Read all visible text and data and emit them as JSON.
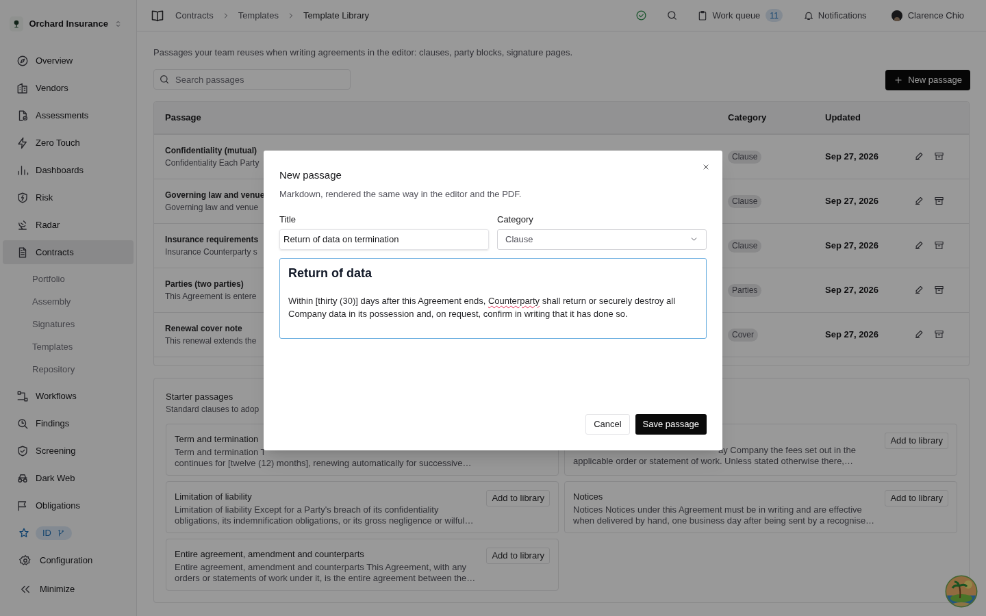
{
  "sidebar": {
    "org": "Orchard Insurance",
    "items": [
      {
        "label": "Overview",
        "selected": false
      },
      {
        "label": "Vendors",
        "selected": false
      },
      {
        "label": "Assessments",
        "selected": false
      },
      {
        "label": "Zero Touch",
        "selected": false
      },
      {
        "label": "Dashboards",
        "selected": false
      },
      {
        "label": "Risk",
        "selected": false
      },
      {
        "label": "Radar",
        "selected": false
      },
      {
        "label": "Contracts",
        "selected": true,
        "children": [
          {
            "label": "Portfolio"
          },
          {
            "label": "Assembly"
          },
          {
            "label": "Signatures"
          },
          {
            "label": "Templates"
          },
          {
            "label": "Repository"
          }
        ]
      },
      {
        "label": "Workflows",
        "selected": false
      },
      {
        "label": "Findings",
        "selected": false
      },
      {
        "label": "Screening",
        "selected": false
      },
      {
        "label": "Dark Web",
        "selected": false
      },
      {
        "label": "Obligations",
        "selected": false
      }
    ],
    "id_badge": "ID",
    "footer": [
      {
        "label": "Configuration"
      },
      {
        "label": "Minimize"
      }
    ]
  },
  "breadcrumbs": [
    "Contracts",
    "Templates",
    "Template Library"
  ],
  "header": {
    "work_queue": "Work queue",
    "work_queue_count": "11",
    "notifications": "Notifications",
    "user": "Clarence Chio"
  },
  "intro": "Passages your team reuses when writing agreements in the editor: clauses, party blocks, signature pages.",
  "search": {
    "placeholder": "Search passages"
  },
  "new_button": "New passage",
  "table": {
    "columns": [
      "Passage",
      "Category",
      "Updated"
    ],
    "rows": [
      {
        "title": "Confidentiality (mutual)",
        "excerpt": "Confidentiality Each Party",
        "category": "Clause",
        "updated": "Sep 27, 2026"
      },
      {
        "title": "Governing law and venue",
        "excerpt": "Governing law and venue",
        "category": "Clause",
        "updated": "Sep 27, 2026"
      },
      {
        "title": "Insurance requirements",
        "excerpt": "Insurance Counterparty s",
        "category": "Clause",
        "updated": "Sep 27, 2026"
      },
      {
        "title": "Parties (two parties)",
        "excerpt": "This Agreement is entere",
        "category": "Parties",
        "updated": "Sep 27, 2026"
      },
      {
        "title": "Renewal cover note",
        "excerpt": "This renewal extends the",
        "category": "Cover",
        "updated": "Sep 27, 2026"
      }
    ]
  },
  "starter": {
    "title": "Starter passages",
    "subtitle": "Standard clauses to adop",
    "cards": [
      {
        "title": "Term and termination",
        "lines": [
          {
            "text": "Term and termination T",
            "kind": "head"
          },
          {
            "text": "continues for [twelve (12) months], renewing automatically for successive…",
            "kind": "full"
          }
        ]
      },
      {
        "lines": [
          {
            "text": "ay Company the fees set out in the",
            "kind": "tail"
          },
          {
            "text": "applicable order or statement of work. Unless stated otherwise there,…",
            "kind": "full"
          }
        ],
        "button": "Add to library"
      },
      {
        "title": "Limitation of liability",
        "lines": [
          {
            "text": "Limitation of liability Except for a Party's breach of its confidentiality",
            "kind": "full"
          },
          {
            "text": "obligations, its indemnification obligations, or its gross negligence or wilful…",
            "kind": "full"
          }
        ],
        "button": "Add to library"
      },
      {
        "title": "Notices",
        "lines": [
          {
            "text": "Notices Notices under this Agreement must be in writing and are effective",
            "kind": "full"
          },
          {
            "text": "when delivered by hand, one business day after being sent by a recognise…",
            "kind": "full"
          }
        ],
        "button": "Add to library"
      },
      {
        "title": "Entire agreement, amendment and counterparts",
        "lines": [
          {
            "text": "Entire agreement, amendment and counterparts This Agreement, with any",
            "kind": "full"
          },
          {
            "text": "orders or statements of work under it, is the entire agreement between the…",
            "kind": "full"
          }
        ],
        "button": "Add to library"
      }
    ]
  },
  "modal": {
    "title": "New passage",
    "subtitle": "Markdown, rendered the same way in the editor and the PDF.",
    "title_label": "Title",
    "title_value": "Return of data on termination",
    "category_label": "Category",
    "category_value": "Clause",
    "editor": {
      "heading": "Return of data",
      "paragraph": [
        {
          "text": "Within [thirty (30)] days after this Agreement ends, ",
          "flagged": false
        },
        {
          "text": "Counterparty",
          "flagged": true
        },
        {
          "text": " shall return or securely destroy all Company data in its possession and, on request, confirm in writing that it has done so.",
          "flagged": false
        }
      ]
    },
    "cancel": "Cancel",
    "save": "Save passage"
  }
}
